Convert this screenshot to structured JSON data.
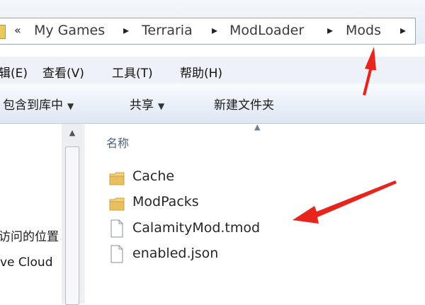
{
  "breadcrumb": {
    "separator": "«",
    "arrow": "▸",
    "items": [
      "My Games",
      "Terraria",
      "ModLoader",
      "Mods"
    ]
  },
  "menu": {
    "edit": "辑(E)",
    "view": "查看(V)",
    "tools": "工具(T)",
    "help": "帮助(H)"
  },
  "commands": {
    "include_library": "包含到库中",
    "share": "共享",
    "new_folder": "新建文件夹"
  },
  "nav_pane": {
    "recent_places": "访问的位置",
    "cloud": "ve Cloud"
  },
  "content": {
    "column_name": "名称",
    "files": [
      {
        "name": "Cache",
        "type": "folder"
      },
      {
        "name": "ModPacks",
        "type": "folder"
      },
      {
        "name": "CalamityMod.tmod",
        "type": "file"
      },
      {
        "name": "enabled.json",
        "type": "file"
      }
    ]
  },
  "colors": {
    "annotation_arrow": "#e8251c",
    "folder": "#e8c060",
    "address_bg": "#ffffff"
  }
}
